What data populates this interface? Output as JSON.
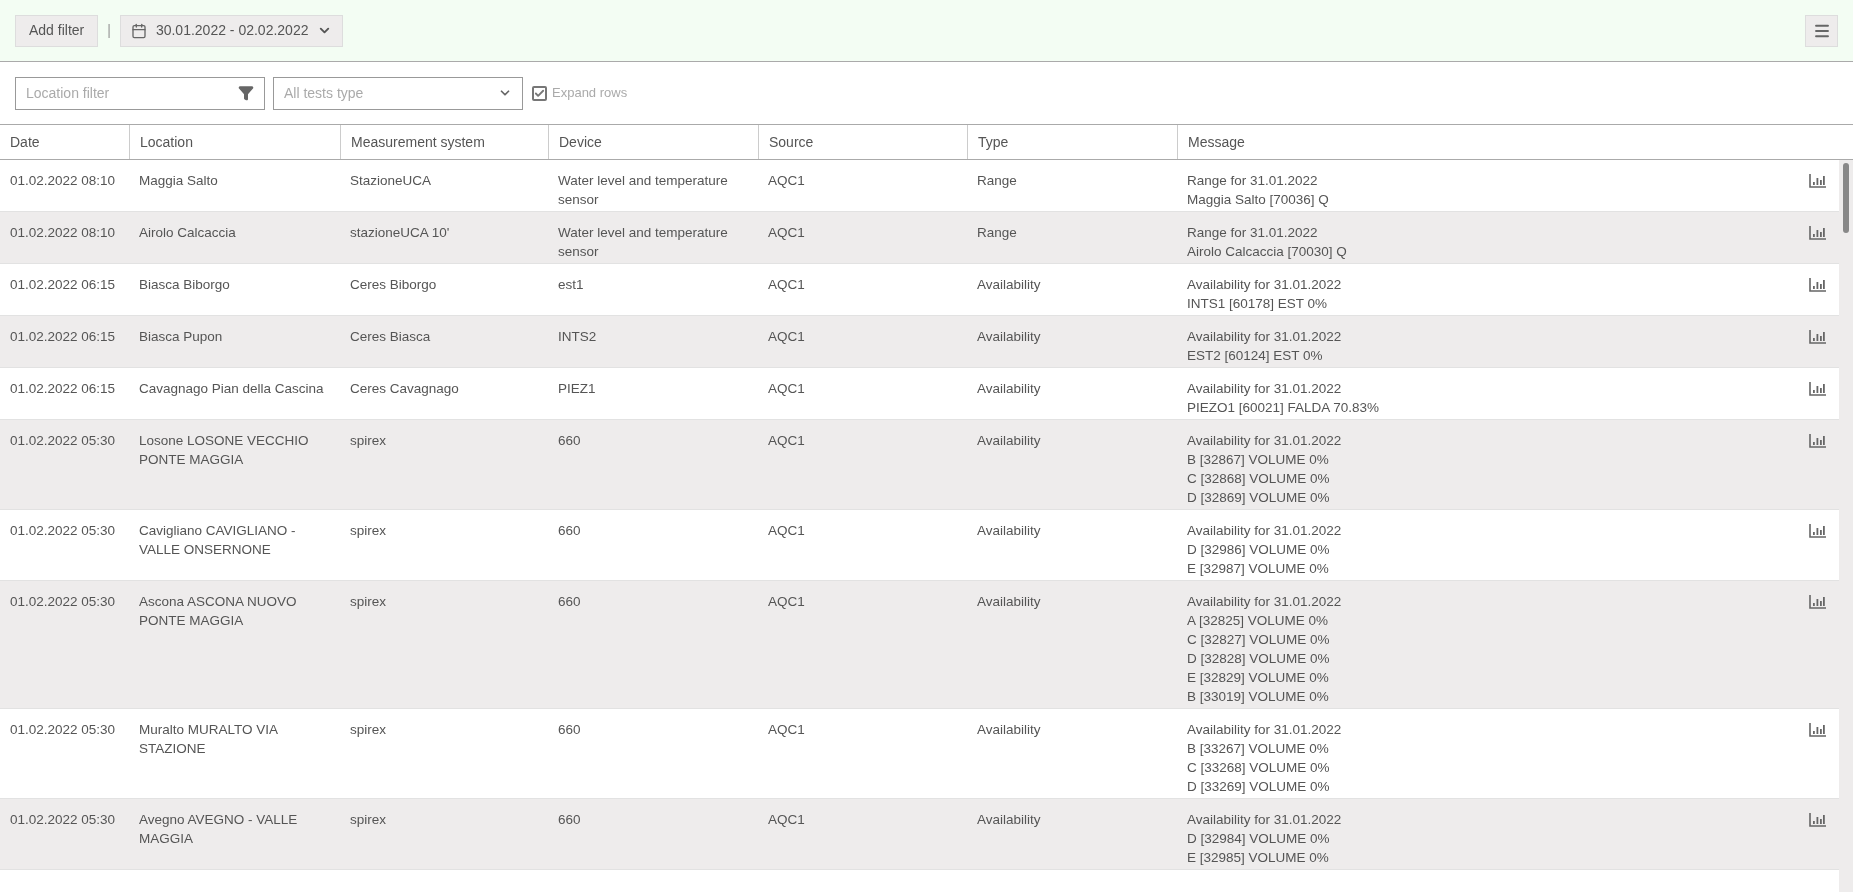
{
  "toolbar": {
    "add_filter": "Add filter",
    "separator": "|",
    "date_range": "30.01.2022 - 02.02.2022"
  },
  "filters": {
    "location_filter": {
      "placeholder": "Location filter"
    },
    "tests_type": {
      "placeholder": "All tests type"
    },
    "expand_rows": {
      "label": "Expand rows",
      "checked": true
    }
  },
  "table": {
    "columns": [
      "Date",
      "Location",
      "Measurement system",
      "Device",
      "Source",
      "Type",
      "Message"
    ],
    "rows": [
      {
        "date": "01.02.2022 08:10",
        "location": "Maggia Salto",
        "measurement_system": "StazioneUCA",
        "device": "Water level and temperature sensor",
        "source": "AQC1",
        "type": "Range",
        "message": [
          "Range for 31.01.2022",
          "Maggia Salto [70036] Q"
        ]
      },
      {
        "date": "01.02.2022 08:10",
        "location": "Airolo Calcaccia",
        "measurement_system": "stazioneUCA 10'",
        "device": "Water level and temperature sensor",
        "source": "AQC1",
        "type": "Range",
        "message": [
          "Range for 31.01.2022",
          "Airolo Calcaccia [70030] Q"
        ]
      },
      {
        "date": "01.02.2022 06:15",
        "location": "Biasca Biborgo",
        "measurement_system": "Ceres Biborgo",
        "device": "est1",
        "source": "AQC1",
        "type": "Availability",
        "message": [
          "Availability for 31.01.2022",
          "INTS1 [60178] EST 0%"
        ]
      },
      {
        "date": "01.02.2022 06:15",
        "location": "Biasca Pupon",
        "measurement_system": "Ceres Biasca",
        "device": "INTS2",
        "source": "AQC1",
        "type": "Availability",
        "message": [
          "Availability for 31.01.2022",
          "EST2 [60124] EST 0%"
        ]
      },
      {
        "date": "01.02.2022 06:15",
        "location": "Cavagnago Pian della Cascina",
        "measurement_system": "Ceres Cavagnago",
        "device": "PIEZ1",
        "source": "AQC1",
        "type": "Availability",
        "message": [
          "Availability for 31.01.2022",
          "PIEZO1 [60021] FALDA 70.83%"
        ]
      },
      {
        "date": "01.02.2022 05:30",
        "location": "Losone LOSONE VECCHIO PONTE MAGGIA",
        "measurement_system": "spirex",
        "device": "660",
        "source": "AQC1",
        "type": "Availability",
        "message": [
          "Availability for 31.01.2022",
          "B [32867] VOLUME 0%",
          "C [32868] VOLUME 0%",
          "D [32869] VOLUME 0%"
        ]
      },
      {
        "date": "01.02.2022 05:30",
        "location": "Cavigliano CAVIGLIANO - VALLE ONSERNONE",
        "measurement_system": "spirex",
        "device": "660",
        "source": "AQC1",
        "type": "Availability",
        "message": [
          "Availability for 31.01.2022",
          "D [32986] VOLUME 0%",
          "E [32987] VOLUME 0%"
        ]
      },
      {
        "date": "01.02.2022 05:30",
        "location": "Ascona ASCONA NUOVO PONTE MAGGIA",
        "measurement_system": "spirex",
        "device": "660",
        "source": "AQC1",
        "type": "Availability",
        "message": [
          "Availability for 31.01.2022",
          "A [32825] VOLUME 0%",
          "C [32827] VOLUME 0%",
          "D [32828] VOLUME 0%",
          "E [32829] VOLUME 0%",
          "B [33019] VOLUME 0%"
        ]
      },
      {
        "date": "01.02.2022 05:30",
        "location": "Muralto MURALTO VIA STAZIONE",
        "measurement_system": "spirex",
        "device": "660",
        "source": "AQC1",
        "type": "Availability",
        "message": [
          "Availability for 31.01.2022",
          "B [33267] VOLUME 0%",
          "C [33268] VOLUME 0%",
          "D [33269] VOLUME 0%"
        ]
      },
      {
        "date": "01.02.2022 05:30",
        "location": "Avegno AVEGNO - VALLE MAGGIA",
        "measurement_system": "spirex",
        "device": "660",
        "source": "AQC1",
        "type": "Availability",
        "message": [
          "Availability for 31.01.2022",
          "D [32984] VOLUME 0%",
          "E [32985] VOLUME 0%"
        ]
      }
    ]
  }
}
